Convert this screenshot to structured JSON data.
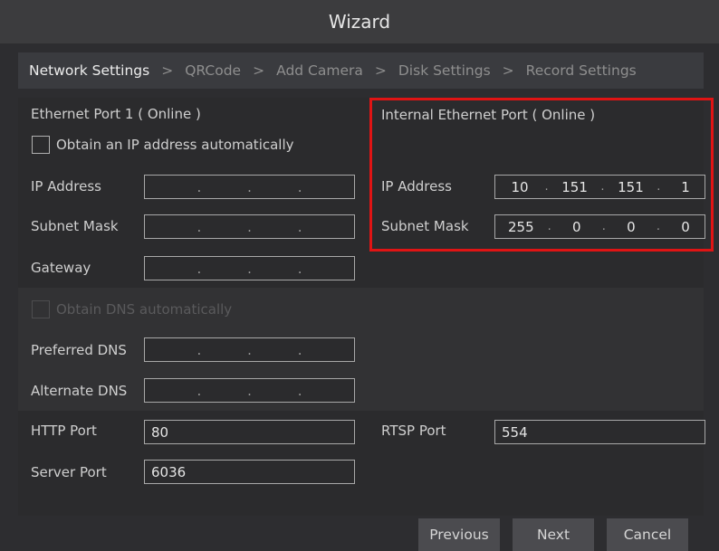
{
  "window": {
    "title": "Wizard"
  },
  "steps": [
    {
      "label": "Network Settings"
    },
    {
      "label": "QRCode"
    },
    {
      "label": "Add Camera"
    },
    {
      "label": "Disk Settings"
    },
    {
      "label": "Record Settings"
    }
  ],
  "step_separator": ">",
  "ethernet1": {
    "title": "Ethernet Port 1 ( Online )",
    "auto_ip_label": "Obtain an IP address automatically",
    "auto_ip_checked": false,
    "ip_label": "IP Address",
    "subnet_label": "Subnet Mask",
    "gateway_label": "Gateway"
  },
  "internal": {
    "title": "Internal Ethernet Port ( Online )",
    "ip_label": "IP Address",
    "ip_octets": [
      "10",
      "151",
      "151",
      "1"
    ],
    "subnet_label": "Subnet Mask",
    "subnet_octets": [
      "255",
      "0",
      "0",
      "0"
    ],
    "highlight_color": "#e01414"
  },
  "dns": {
    "auto_label": "Obtain DNS automatically",
    "auto_checked": false,
    "auto_disabled": true,
    "preferred_label": "Preferred DNS",
    "alternate_label": "Alternate DNS"
  },
  "ports": {
    "http_label": "HTTP Port",
    "http_value": "80",
    "rtsp_label": "RTSP Port",
    "rtsp_value": "554",
    "server_label": "Server Port",
    "server_value": "6036"
  },
  "footer": {
    "previous_label": "Previous",
    "next_label": "Next",
    "cancel_label": "Cancel"
  }
}
